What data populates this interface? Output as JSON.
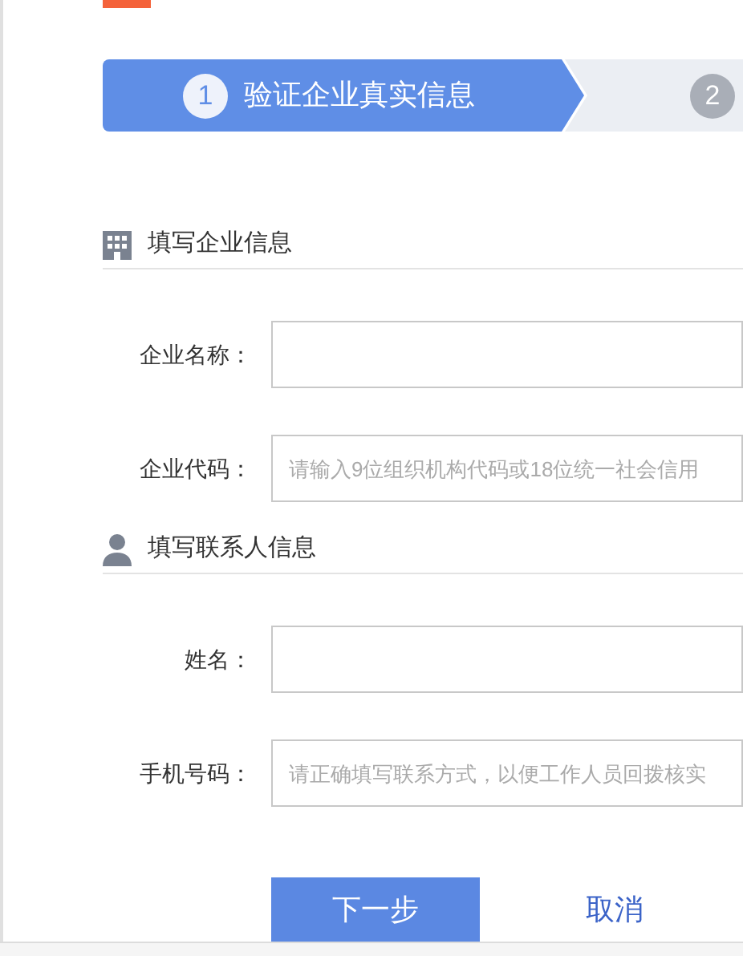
{
  "steps": [
    {
      "number": "1",
      "label": "验证企业真实信息",
      "selected": true
    },
    {
      "number": "2",
      "selected": false
    }
  ],
  "sections": [
    {
      "kind": "company",
      "title": "填写企业信息",
      "fields": [
        {
          "label": "企业名称："
        },
        {
          "label": "企业代码：",
          "placeholder": "请输入9位组织机构代码或18位统一社会信用"
        }
      ]
    },
    {
      "kind": "person",
      "title": "填写联系人信息",
      "fields": [
        {
          "label": "姓名："
        },
        {
          "label": "手机号码：",
          "placeholder": "请正确填写联系方式，以便工作人员回拨核实"
        }
      ]
    }
  ],
  "buttons": {
    "next": "下一步",
    "cancel": "取消"
  }
}
